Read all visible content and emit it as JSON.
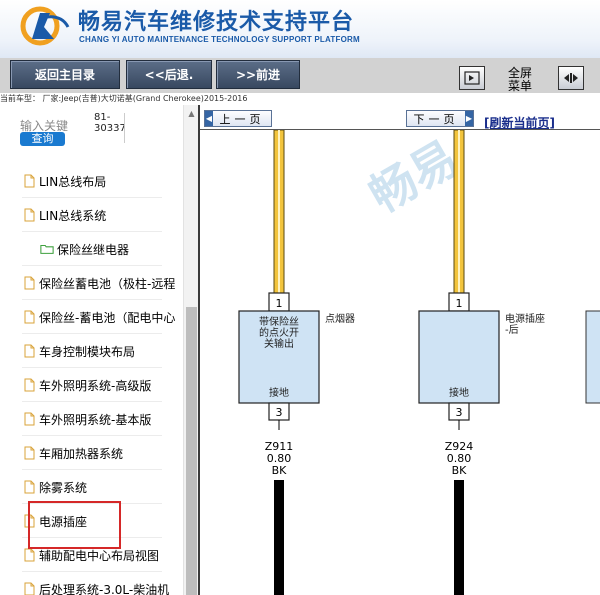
{
  "header": {
    "title_cn": "畅易汽车维修技术支持平台",
    "title_en": "CHANG YI AUTO MAINTENANCE TECHNOLOGY SUPPORT PLATFORM"
  },
  "toolbar": {
    "home": "返回主目录",
    "back": "<<后退.",
    "forward": ">>前进",
    "menu_line1": "全屏",
    "menu_line2": "菜单"
  },
  "vehicle_info": "当前车型：  厂家:Jeep(吉普)大切诺基(Grand Cherokee)2015-2016",
  "sidebar": {
    "search_label": "输入关键",
    "search_value_line1": "81-",
    "search_value_line2": "30337",
    "search_button": "查询",
    "items": [
      {
        "label": "LIN总线布局",
        "type": "doc"
      },
      {
        "label": "LIN总线系统",
        "type": "doc"
      },
      {
        "label": "保险丝继电器",
        "type": "folder"
      },
      {
        "label": "保险丝蓄电池（极柱-远程",
        "type": "doc"
      },
      {
        "label": "保险丝-蓄电池（配电中心",
        "type": "doc"
      },
      {
        "label": "车身控制模块布局",
        "type": "doc"
      },
      {
        "label": "车外照明系统-高级版",
        "type": "doc"
      },
      {
        "label": "车外照明系统-基本版",
        "type": "doc"
      },
      {
        "label": "车厢加热器系统",
        "type": "doc"
      },
      {
        "label": "除雾系统",
        "type": "doc"
      },
      {
        "label": "电源插座",
        "type": "doc"
      },
      {
        "label": "辅助配电中心布局视图",
        "type": "doc"
      },
      {
        "label": "后处理系统-3.0L-柴油机",
        "type": "doc"
      }
    ]
  },
  "main": {
    "prev_page": "上一页",
    "next_page": "下一页",
    "refresh": "[刷新当前页]",
    "watermark": "畅易",
    "components": [
      {
        "pin_top": "1",
        "inner_text": "带保险丝的点火开关输出",
        "side_label": "点烟器",
        "ground": "接地",
        "pin_bottom": "3",
        "wire_code": "Z911",
        "wire_size": "0.80",
        "wire_color": "BK"
      },
      {
        "pin_top": "1",
        "inner_text": "",
        "side_label": "电源插座-后",
        "ground": "接地",
        "pin_bottom": "3",
        "wire_code": "Z924",
        "wire_size": "0.80",
        "wire_color": "BK"
      }
    ]
  },
  "colors": {
    "title_blue": "#1a5aa8",
    "wire_yellow": "#f2c43d",
    "component_fill": "#cfe3f4",
    "highlight_red": "#d52828"
  }
}
